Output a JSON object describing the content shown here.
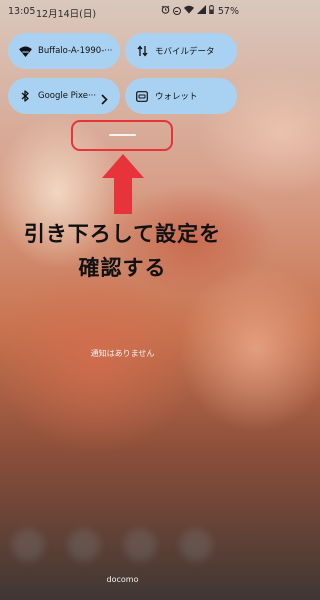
{
  "status_bar": {
    "time": "13:05",
    "date": "12月14日(日)",
    "battery": "57%",
    "icons": [
      "alarm-icon",
      "do-not-disturb-icon",
      "wifi-icon",
      "signal-icon",
      "battery-icon"
    ]
  },
  "quick_settings": {
    "tiles": [
      {
        "label": "Buffalo-A-1990-···",
        "icon": "wifi-icon",
        "has_chevron": true
      },
      {
        "label": "モバイルデータ",
        "icon": "mobile-data-icon",
        "has_chevron": false
      },
      {
        "label": "Google Pixe···",
        "icon": "bluetooth-icon",
        "has_chevron": true
      },
      {
        "label": "ウォレット",
        "icon": "wallet-icon",
        "has_chevron": false
      }
    ]
  },
  "annotation": {
    "line1": "引き下ろして設定を",
    "line2": "確認する",
    "highlight_color": "#e6343a"
  },
  "notifications": {
    "empty_text": "通知はありません"
  },
  "carrier": "docomo",
  "colors": {
    "tile_bg": "#a9d2f2",
    "accent_red": "#e6343a"
  }
}
